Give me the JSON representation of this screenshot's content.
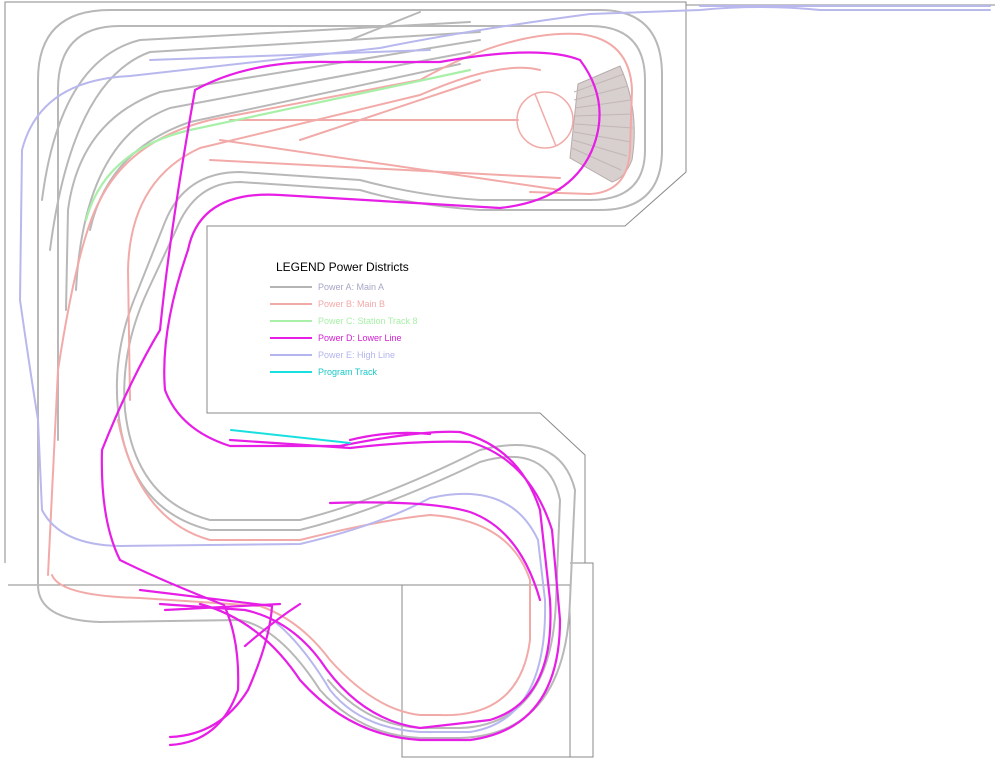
{
  "legend": {
    "title": "LEGEND Power Districts",
    "items": [
      {
        "label": "Power A: Main A",
        "color": "#b4b4b4",
        "text_color": "#a6a6c6"
      },
      {
        "label": "Power B: Main B",
        "color": "#f2aaa8",
        "text_color": "#f2aaa8"
      },
      {
        "label": "Power C: Station Track 8",
        "color": "#a8f0a8",
        "text_color": "#a8f0a8"
      },
      {
        "label": "Power D: Lower Line",
        "color": "#e61ee6",
        "text_color": "#d21ed2"
      },
      {
        "label": "Power E: High Line",
        "color": "#b4b4ee",
        "text_color": "#b4b4ee"
      },
      {
        "label": "Program Track",
        "color": "#18e0e0",
        "text_color": "#18c8c8"
      }
    ]
  }
}
